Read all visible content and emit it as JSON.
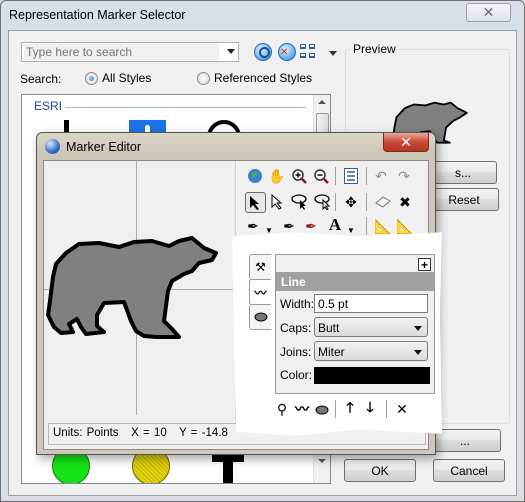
{
  "outer_window": {
    "title": "Representation Marker Selector",
    "close_label": "✕",
    "search": {
      "placeholder": "Type here to search",
      "value": ""
    },
    "search_icons": [
      "search-icon",
      "clear-search-icon",
      "view-grid-icon"
    ],
    "search_label": "Search:",
    "radios": [
      {
        "label": "All Styles",
        "checked": true
      },
      {
        "label": "Referenced Styles",
        "checked": false
      }
    ],
    "gallery": {
      "group_label": "ESRI",
      "markers": [
        "pole",
        "blue-marker",
        "anchor",
        "green-circle",
        "yellow-circle",
        "cross"
      ]
    },
    "preview": {
      "label": "Preview",
      "symbol": "bear"
    },
    "buttons": {
      "properties": "Properties...",
      "properties_visible": "s...",
      "reset": "Reset",
      "more": "...",
      "ok": "OK",
      "cancel": "Cancel"
    }
  },
  "marker_editor": {
    "title": "Marker Editor",
    "close_label": "✕",
    "toolbar": {
      "row1": [
        "globe-icon",
        "pan-hand-icon",
        "zoom-in-icon",
        "zoom-out-icon",
        "list-icon",
        "undo-icon",
        "redo-icon"
      ],
      "row2": [
        "select-r-icon",
        "direct-select-r-icon",
        "lasso-select-icon",
        "lasso-direct-select-icon",
        "center-icon",
        "eraser-icon",
        "delete-icon"
      ],
      "row3": [
        "pen-add-icon",
        "curve-pen-icon",
        "shape-pen-icon",
        "text-icon",
        "measure-icon",
        "measure-alt-icon"
      ]
    },
    "status": {
      "units": "Units: Points",
      "x": "X = 10",
      "y": "Y = -14.8"
    },
    "colors": {
      "fill": "#808080",
      "outline": "#000000"
    }
  },
  "layer_panel": {
    "tabs": [
      "marker-layer-tab",
      "line-tab",
      "fill-tab"
    ],
    "add_label": "+",
    "header": "Line",
    "width_label": "Width:",
    "width_value": "0.5 pt",
    "caps_label": "Caps:",
    "caps_value": "Butt",
    "joins_label": "Joins:",
    "joins_value": "Miter",
    "color_label": "Color:",
    "color_value": "#000000",
    "tools": [
      "add-marker-icon",
      "add-stroke-icon",
      "add-fill-icon",
      "move-up-icon",
      "move-down-icon",
      "remove-icon"
    ]
  }
}
